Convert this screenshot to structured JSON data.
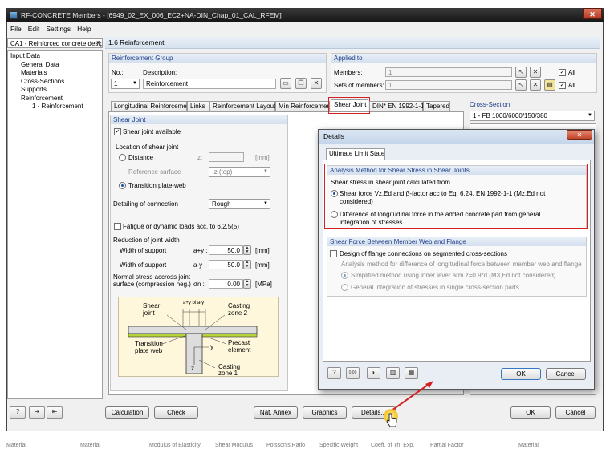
{
  "window": {
    "title": "RF-CONCRETE Members - [6949_02_EX_006_EC2+NA-DIN_Chap_01_CAL_RFEM]",
    "close": "✕"
  },
  "menu": [
    "File",
    "Edit",
    "Settings",
    "Help"
  ],
  "case_combo": "CA1 - Reinforced concrete design",
  "tree": {
    "root": "Input Data",
    "items": [
      "General Data",
      "Materials",
      "Cross-Sections",
      "Supports",
      "Reinforcement"
    ],
    "sub": "1 - Reinforcement"
  },
  "section_header": "1.6 Reinforcement",
  "reinf_group": {
    "title": "Reinforcement Group",
    "no_label": "No.:",
    "no_value": "1",
    "desc_label": "Description:",
    "desc_value": "Reinforcement"
  },
  "applied_to": {
    "title": "Applied to",
    "members_label": "Members:",
    "members_value": "1",
    "sets_label": "Sets of members:",
    "sets_value": "1",
    "all_label": "All"
  },
  "tabs": [
    "Longitudinal Reinforcement",
    "Links",
    "Reinforcement Layout",
    "Min Reinforcement",
    "Shear Joint",
    "DIN* EN 1992-1-1",
    "Tapered"
  ],
  "shear_joint": {
    "title": "Shear Joint",
    "available": "Shear joint available",
    "location_label": "Location of shear joint",
    "distance": "Distance",
    "z_label": "z:",
    "z_unit": "[mm]",
    "ref_surface_label": "Reference surface",
    "ref_surface_value": "-z (top)",
    "transition": "Transition plate-web",
    "detailing_label": "Detailing of connection",
    "detailing_value": "Rough",
    "fatigue": "Fatigue or dynamic loads acc. to 6.2.5(5)",
    "reduction_label": "Reduction of joint width",
    "width_support_1": "Width of support",
    "a_plus_y": "a+y :",
    "a_plus_y_value": "50.0",
    "a_minus_y": "a-y :",
    "a_minus_y_value": "50.0",
    "unit_mm": "[mm]",
    "normal_stress_1": "Normal stress accross joint",
    "normal_stress_2": "surface (compression neg.)",
    "sigma_n": "σn :",
    "sigma_value": "0.00",
    "unit_mpa": "[MPa]"
  },
  "sketch": {
    "shear_joint": "Shear joint",
    "casting_zone2": "Casting zone 2",
    "transition": "Transition plate web",
    "precast": "Precast element",
    "casting_zone1": "Casting zone 1",
    "dims": "a+y  bi  a-y",
    "y": "y",
    "z": "z"
  },
  "cross_section": {
    "title": "Cross-Section",
    "value": "1 - FB 1000/6000/150/380"
  },
  "details_dialog": {
    "title": "Details",
    "close": "✕",
    "tab": "Ultimate Limit State",
    "analysis_title": "Analysis Method for Shear Stress in Shear Joints",
    "calc_from": "Shear stress in shear joint calculated from...",
    "opt1_line1": "Shear force Vz,Ed and β-factor acc to Eq. 6.24, EN 1992-1-1 (Mz,Ed not",
    "opt1_line2": "considered)",
    "opt2_line1": "Difference of longitudinal force in the added concrete part from general",
    "opt2_line2": "integration of stresses",
    "flange_title": "Shear Force Between Member Web and Flange",
    "flange_chk": "Design of flange connections on segmented cross-sections",
    "flange_method": "Analysis method for difference of longitudinal force between member web and flange",
    "flange_opt1": "Simplified method using inner lever arm z=0.9*d (M3,Ed not considered)",
    "flange_opt2": "General integration of stresses in single cross-section parts",
    "ok": "OK",
    "cancel": "Cancel"
  },
  "bottom_buttons": {
    "calculation": "Calculation",
    "check": "Check",
    "nat_annex": "Nat. Annex",
    "graphics": "Graphics",
    "details": "Details...",
    "ok": "OK",
    "cancel": "Cancel"
  },
  "status_columns": [
    "Material",
    "Material",
    "Modulus of Elasticity",
    "Shear Modulus",
    "Poisson's Ratio",
    "Specific Weight",
    "Coeff. of Th. Exp.",
    "Partial Factor",
    "Material"
  ],
  "colors": {
    "highlight": "#d42020",
    "group_title": "#1d3f8a",
    "flange_green": "#b5d33a"
  }
}
